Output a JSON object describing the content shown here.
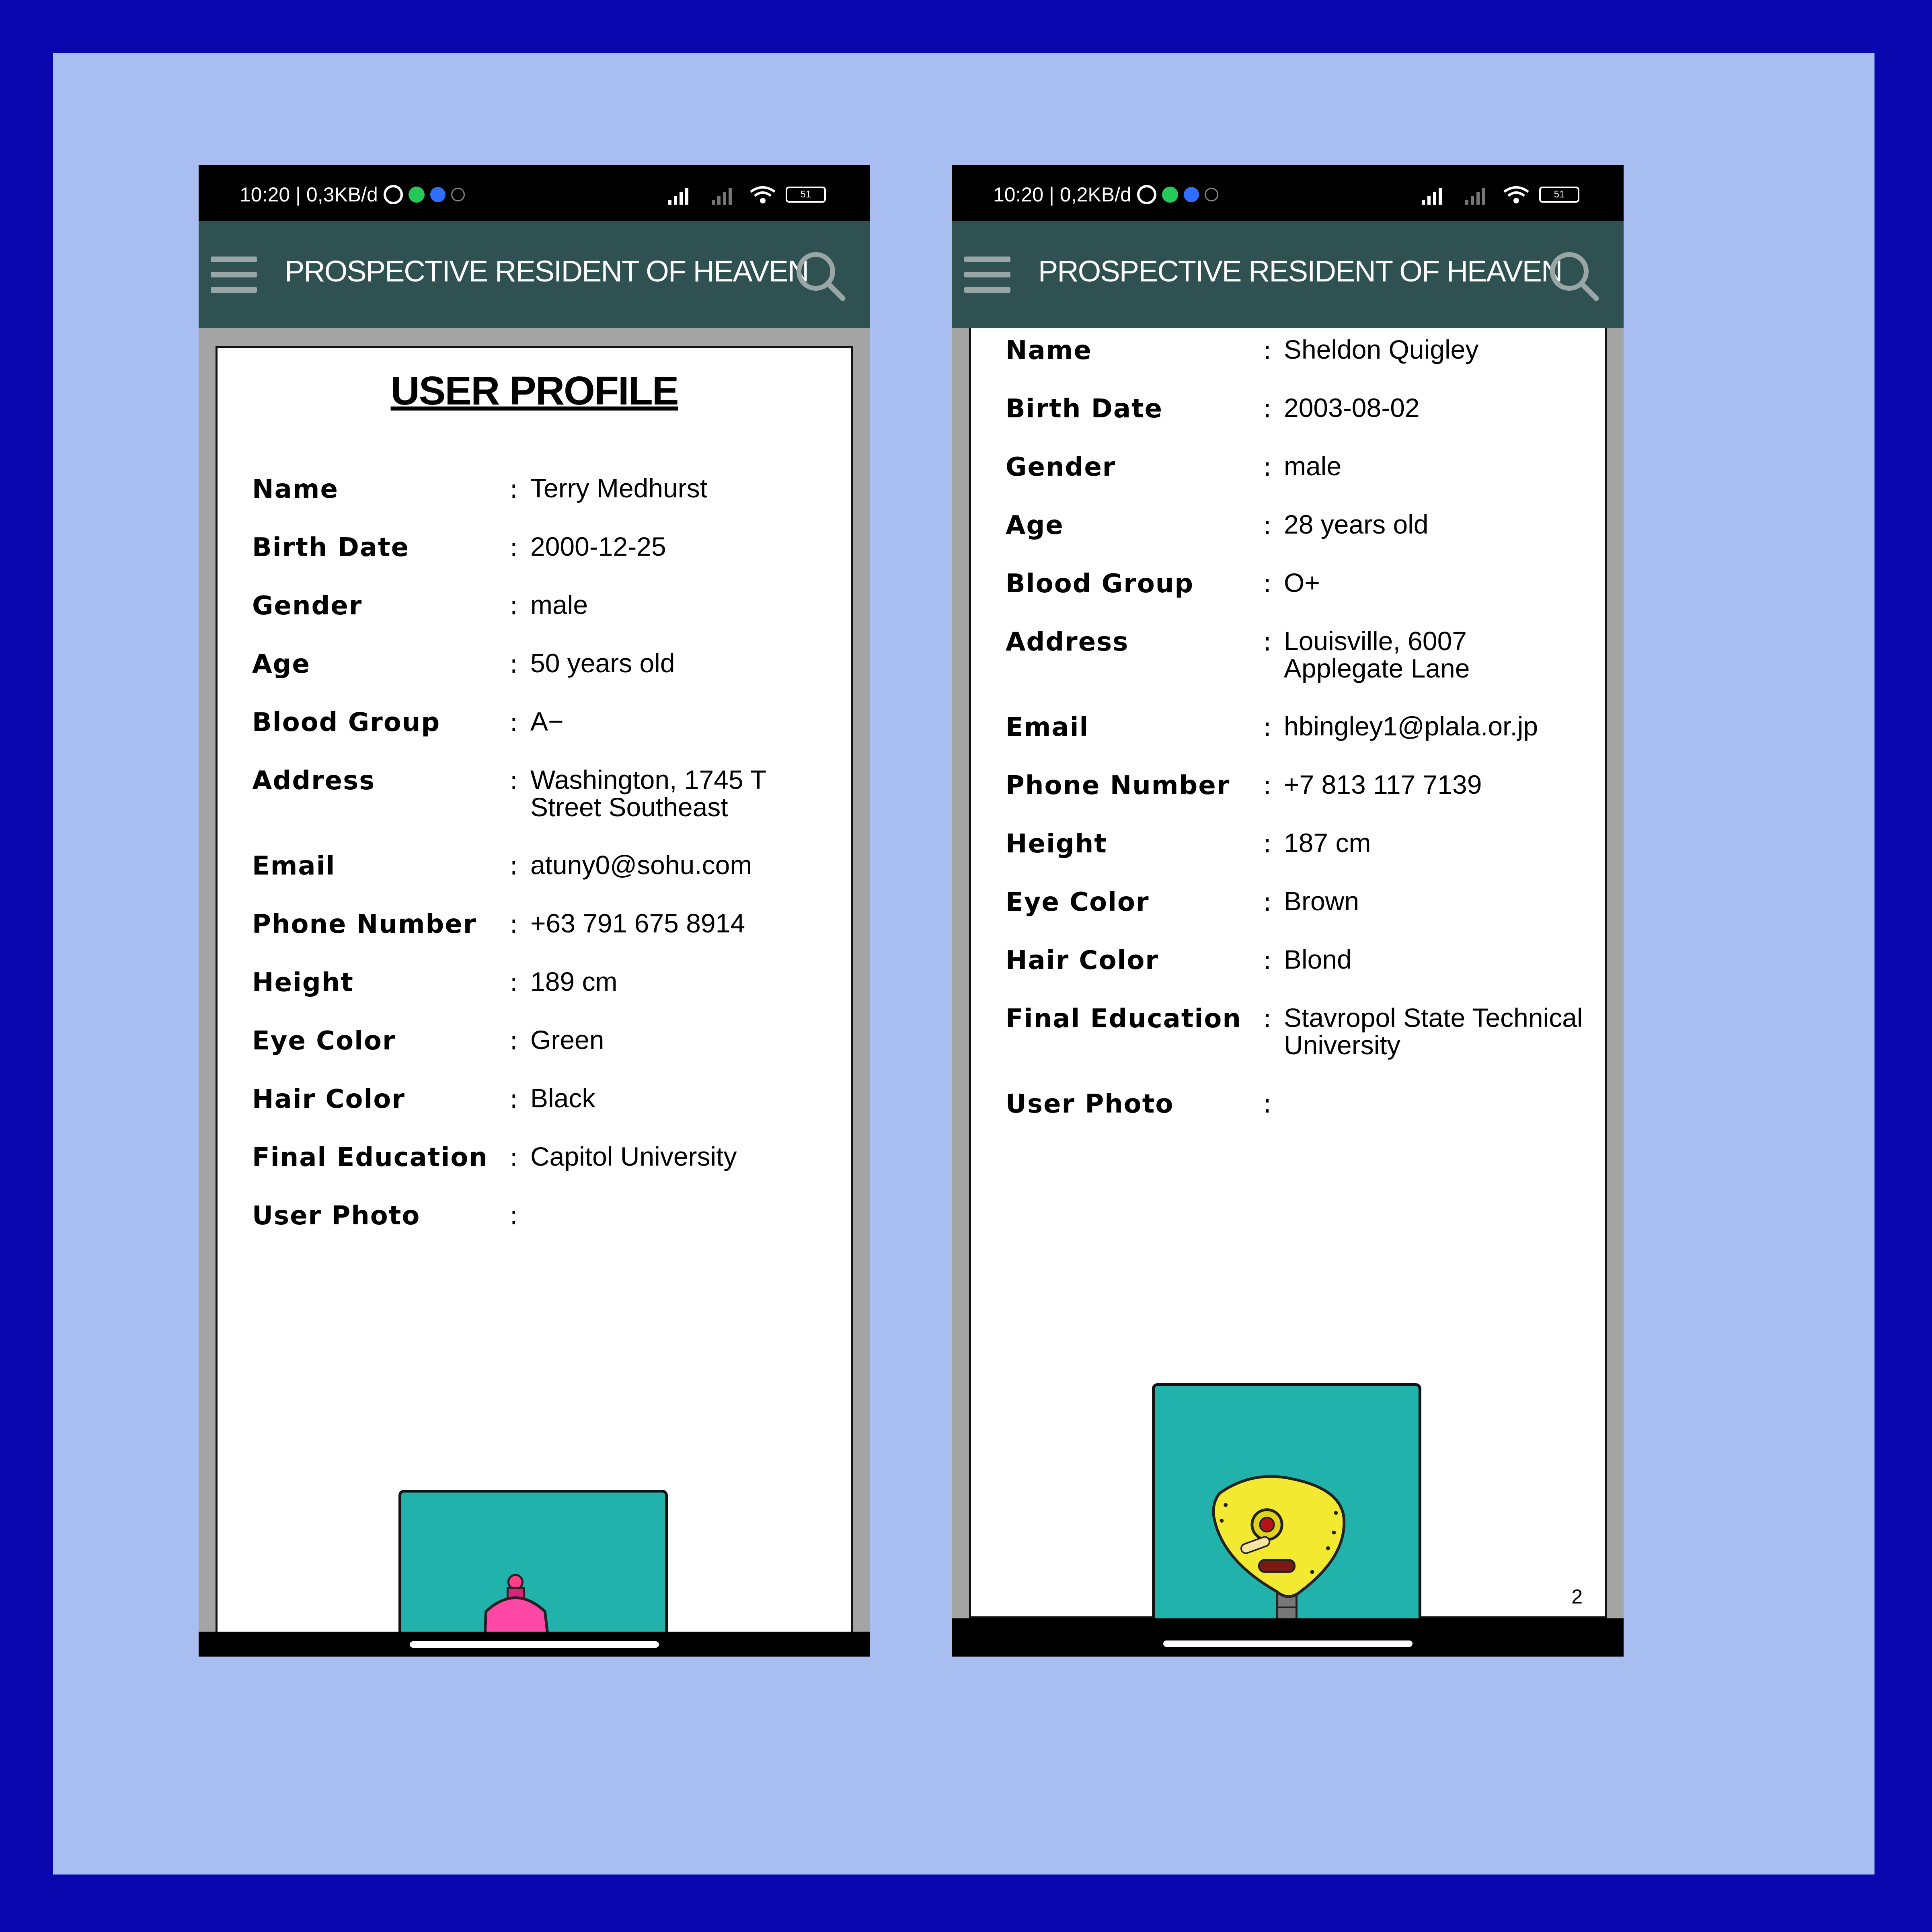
{
  "screens": [
    {
      "status": {
        "time_speed": "10:20 | 0,3KB/d",
        "network": "4G+",
        "battery": "51"
      },
      "app_title": "PROSPECTIVE RESIDENT OF HEAVEN",
      "profile_title": "USER PROFILE",
      "fields": [
        {
          "label": "Name",
          "value": "Terry Medhurst"
        },
        {
          "label": "Birth Date",
          "value": "2000-12-25"
        },
        {
          "label": "Gender",
          "value": "male"
        },
        {
          "label": "Age",
          "value": "50 years old"
        },
        {
          "label": "Blood Group",
          "value": "A−"
        },
        {
          "label": "Address",
          "value": "Washington, 1745 T Street Southeast"
        },
        {
          "label": "Email",
          "value": "atuny0@sohu.com"
        },
        {
          "label": "Phone Number",
          "value": "+63 791 675 8914"
        },
        {
          "label": "Height",
          "value": "189 cm"
        },
        {
          "label": "Eye Color",
          "value": "Green"
        },
        {
          "label": "Hair Color",
          "value": "Black"
        },
        {
          "label": "Final Education",
          "value": "Capitol University"
        },
        {
          "label": "User Photo",
          "value": ""
        }
      ],
      "photo_icon": "pink-robot-avatar"
    },
    {
      "status": {
        "time_speed": "10:20 | 0,2KB/d",
        "network": "4G",
        "battery": "51"
      },
      "app_title": "PROSPECTIVE RESIDENT OF HEAVEN",
      "fields": [
        {
          "label": "Name",
          "value": "Sheldon Quigley"
        },
        {
          "label": "Birth Date",
          "value": "2003-08-02"
        },
        {
          "label": "Gender",
          "value": "male"
        },
        {
          "label": "Age",
          "value": "28 years old"
        },
        {
          "label": "Blood Group",
          "value": "O+"
        },
        {
          "label": "Address",
          "value": "Louisville, 6007 Applegate Lane"
        },
        {
          "label": "Email",
          "value": "hbingley1@plala.or.jp"
        },
        {
          "label": "Phone Number",
          "value": "+7 813 117 7139"
        },
        {
          "label": "Height",
          "value": "187 cm"
        },
        {
          "label": "Eye Color",
          "value": "Brown"
        },
        {
          "label": "Hair Color",
          "value": "Blond"
        },
        {
          "label": "Final Education",
          "value": "Stavropol State Technical University"
        },
        {
          "label": "User Photo",
          "value": ""
        }
      ],
      "photo_icon": "yellow-robot-avatar",
      "page_number": "2"
    }
  ],
  "colors": {
    "outer_border": "#0a06ad",
    "background": "#a8bdf0",
    "appbar": "#2f5151",
    "photo_bg": "#21b3ab"
  }
}
